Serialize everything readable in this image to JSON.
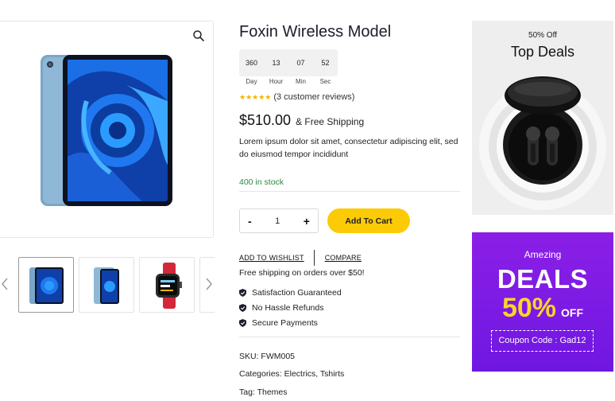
{
  "product": {
    "title": "Foxin Wireless Model",
    "countdown": [
      {
        "value": "360",
        "label": "Day"
      },
      {
        "value": "13",
        "label": "Hour"
      },
      {
        "value": "07",
        "label": "Min"
      },
      {
        "value": "52",
        "label": "Sec"
      }
    ],
    "rating_stars": "★★★★★",
    "reviews": "(3 customer reviews)",
    "price": "$510.00",
    "shipping": "& Free Shipping",
    "description": "Lorem ipsum dolor sit amet, consectetur adipiscing elit, sed do eiusmod tempor incididunt",
    "stock": "400 in stock",
    "quantity": "1",
    "qty_minus": "-",
    "qty_plus": "+",
    "add_to_cart": "Add To Cart",
    "wishlist": "ADD TO WISHLIST",
    "compare": "COMPARE",
    "free_shipping_note": "Free shipping on orders over $50!",
    "features": [
      "Satisfaction Guaranteed",
      "No Hassle Refunds",
      "Secure Payments"
    ],
    "sku": "SKU: FWM005",
    "categories": "Categories: Electrics, Tshirts",
    "tag": "Tag: Themes"
  },
  "gallery": {
    "zoom_icon": "search-icon",
    "prev_icon": "chevron-left-icon",
    "next_icon": "chevron-right-icon"
  },
  "banner_top": {
    "small": "50% Off",
    "big": "Top Deals"
  },
  "banner_bottom": {
    "small": "Amezing",
    "deals": "DEALS",
    "percent": "50%",
    "off": "OFF",
    "coupon": "Coupon Code : Gad12"
  },
  "colors": {
    "accent": "#fccb05",
    "stock": "#2b8a3e",
    "banner_purple": "#7a1be4",
    "banner_yellow": "#fcd32a"
  }
}
